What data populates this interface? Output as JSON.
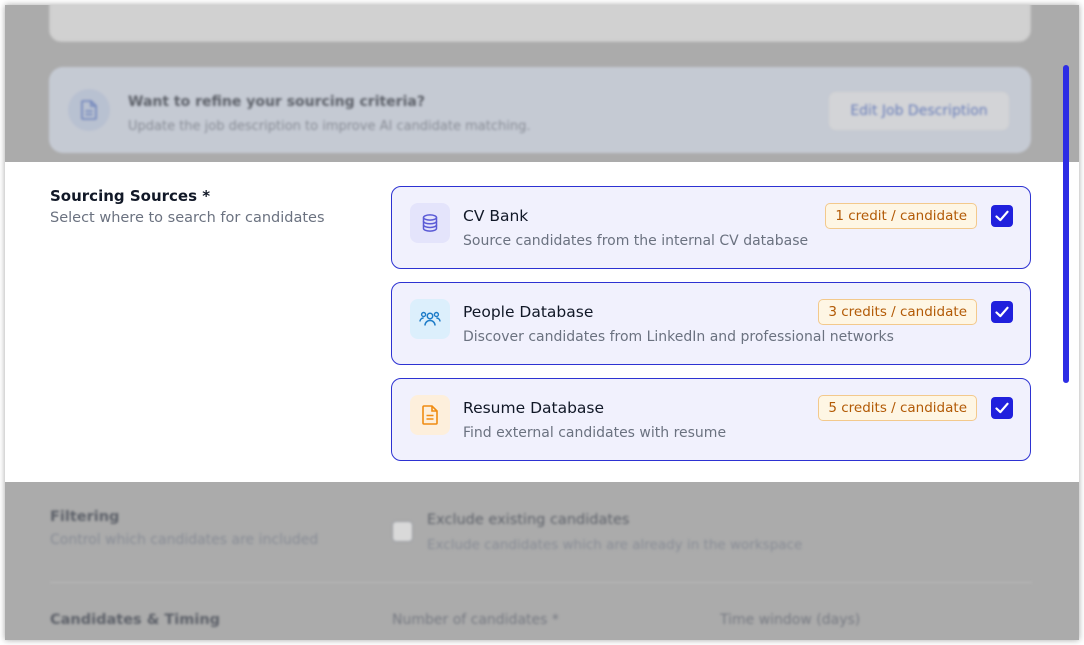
{
  "refine_banner": {
    "title": "Want to refine your sourcing criteria?",
    "subtitle": "Update the job description to improve AI candidate matching.",
    "button_label": "Edit Job Description"
  },
  "sourcing": {
    "title": "Sourcing Sources *",
    "subtitle": "Select where to search for candidates",
    "sources": [
      {
        "name": "CV Bank",
        "description": "Source candidates from the internal CV database",
        "credits": "1 credit / candidate",
        "checked": true,
        "icon": "database-icon",
        "icon_color": "#5b5bd6",
        "icon_bg": "#e4e4fb"
      },
      {
        "name": "People Database",
        "description": "Discover candidates from LinkedIn and professional networks",
        "credits": "3 credits / candidate",
        "checked": true,
        "icon": "users-icon",
        "icon_color": "#1e7cc8",
        "icon_bg": "#dceffc"
      },
      {
        "name": "Resume Database",
        "description": "Find external candidates with resume",
        "credits": "5 credits / candidate",
        "checked": true,
        "icon": "file-icon",
        "icon_color": "#f08c12",
        "icon_bg": "#fdefdc"
      }
    ]
  },
  "filtering": {
    "title": "Filtering",
    "subtitle": "Control which candidates are included",
    "exclude_label": "Exclude existing candidates",
    "exclude_description": "Exclude candidates which are already in the workspace",
    "exclude_checked": false
  },
  "timing": {
    "title": "Candidates & Timing",
    "number_label": "Number of candidates *",
    "window_label": "Time window (days)"
  },
  "colors": {
    "accent": "#2020dd",
    "card_border": "#2d32d2",
    "card_bg": "#f1f1fd",
    "badge_text": "#b25a06",
    "badge_bg": "#fef6e4",
    "overlay": "#ababab"
  }
}
